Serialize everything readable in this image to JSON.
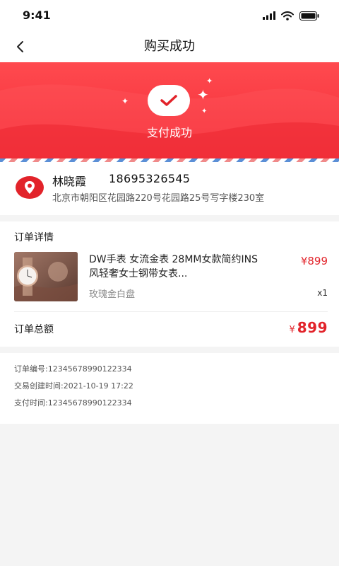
{
  "status_bar": {
    "time": "9:41"
  },
  "nav": {
    "title": "购买成功"
  },
  "hero": {
    "message": "支付成功"
  },
  "address": {
    "name": "林晓霞",
    "phone": "18695326545",
    "detail": "北京市朝阳区花园路220号花园路25号写字楼230室"
  },
  "order": {
    "title": "订单详情",
    "product": {
      "name_line1": "DW手表 女流金表 28MM女款简约INS",
      "name_line2": "风轻奢女士钢带女表...",
      "price": "¥899",
      "variant": "玫瑰金白盘",
      "quantity": "x1"
    },
    "total_label": "订单总额",
    "total_currency": "¥",
    "total_amount": "899"
  },
  "info": {
    "order_no": "订单编号:12345678990122334",
    "created_at": "交易创建时间:2021-10-19 17:22",
    "paid_at": "支付时间:12345678990122334"
  },
  "colors": {
    "accent": "#e2232a",
    "hero": "#f22b36"
  }
}
